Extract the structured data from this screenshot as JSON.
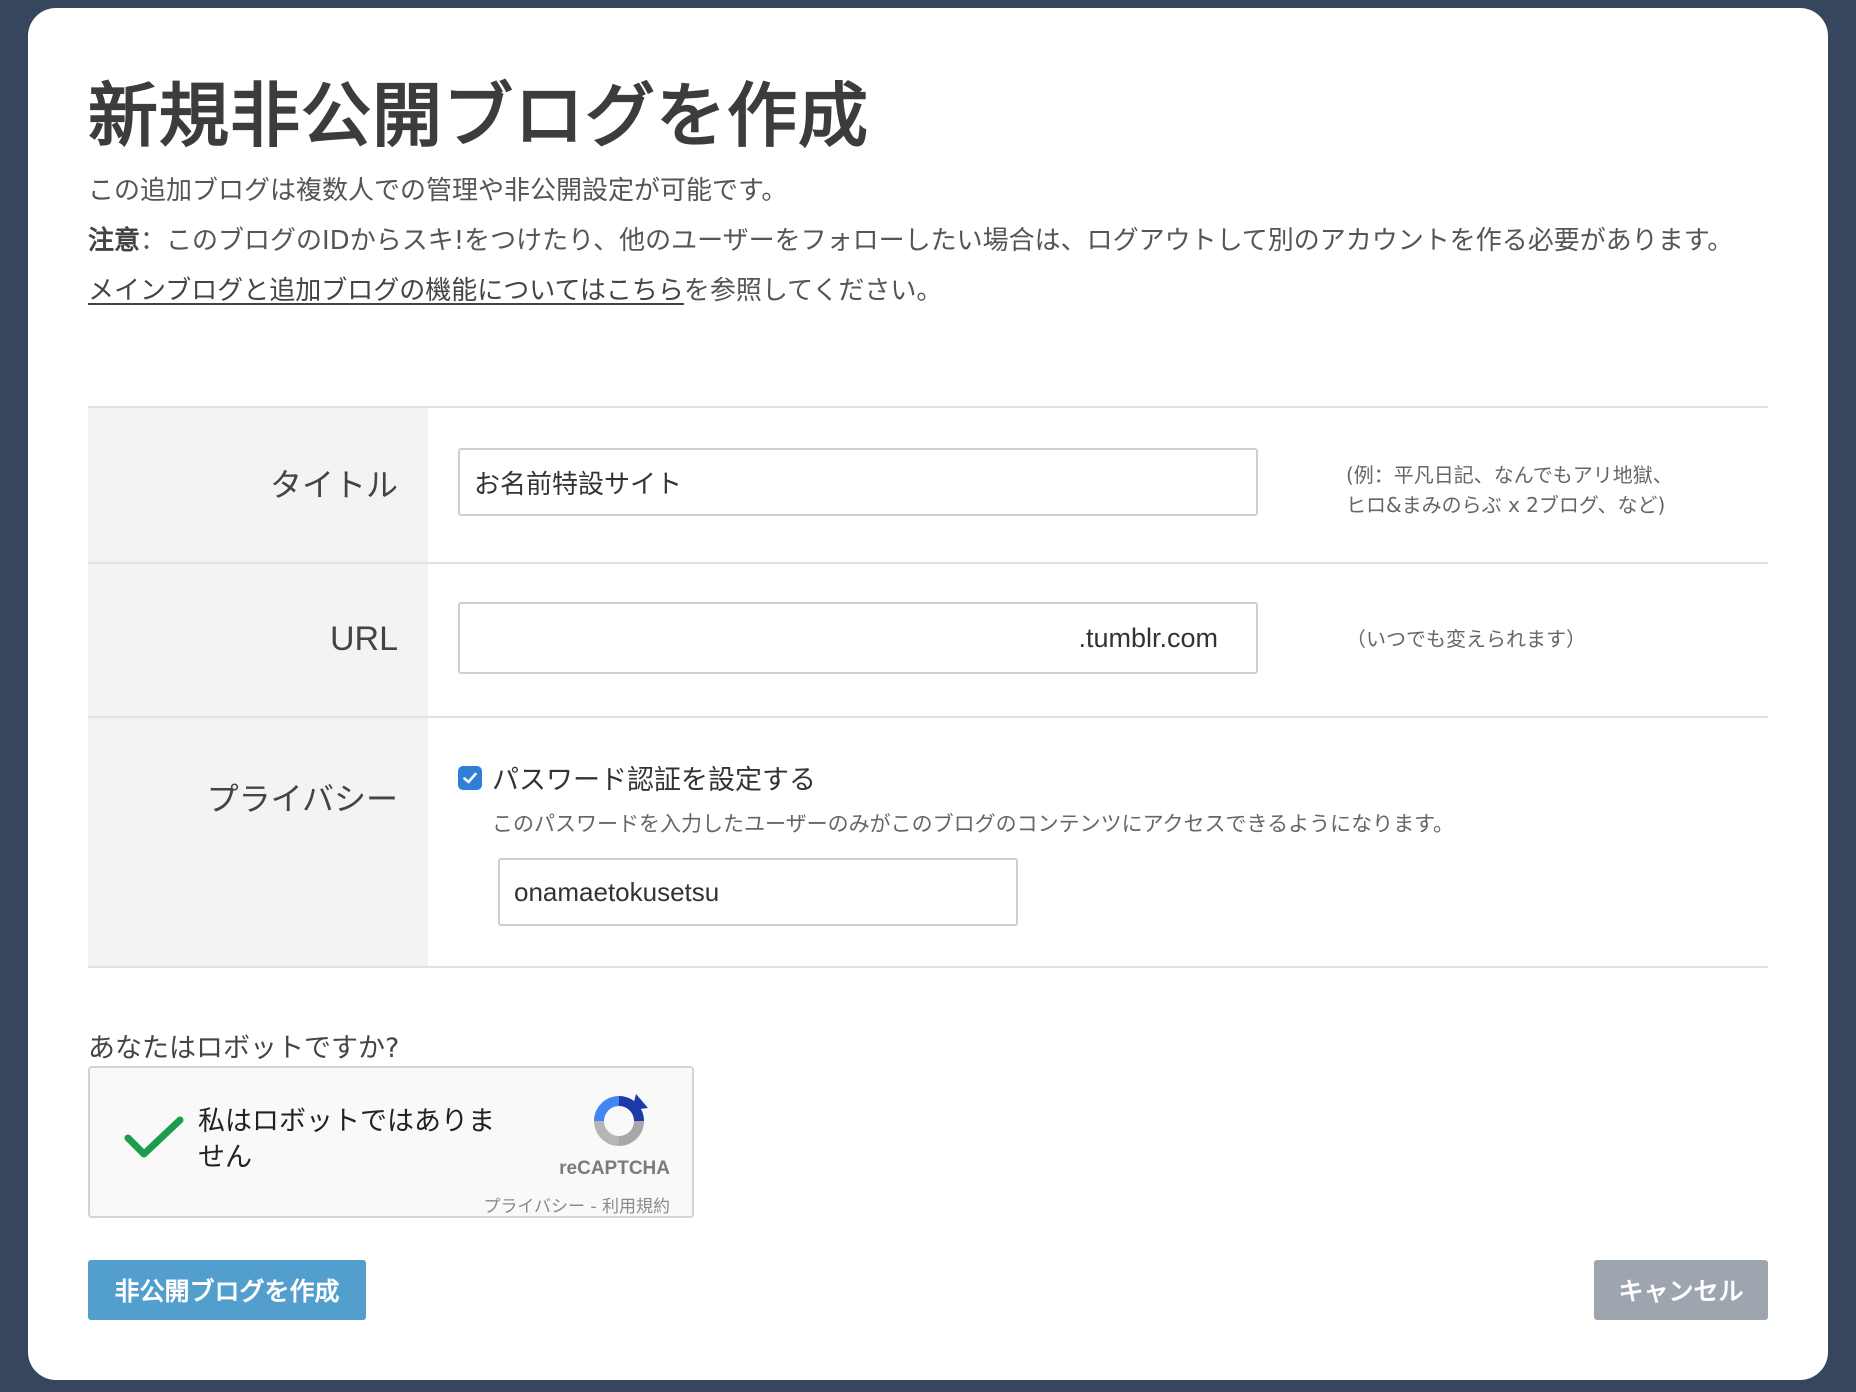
{
  "page": {
    "title": "新規非公開ブログを作成",
    "intro_line1": "この追加ブログは複数人での管理や非公開設定が可能です。",
    "notice_label": "注意",
    "notice_text": "：このブログのIDからスキ!をつけたり、他のユーザーをフォローしたい場合は、ログアウトして別のアカウントを作る必要があります。",
    "help_link": "メインブログと追加ブログの機能についてはこちら",
    "help_suffix": "を参照してください。"
  },
  "form": {
    "title_label": "タイトル",
    "title_value": "お名前特設サイト",
    "title_hint_1": "(例：平凡日記、なんでもアリ地獄、",
    "title_hint_2": "ヒロ&まみのらぶ x 2ブログ、など)",
    "url_label": "URL",
    "url_suffix": ".tumblr.com",
    "url_hint": "（いつでも変えられます）",
    "privacy_label": "プライバシー",
    "password_checkbox_label": "パスワード認証を設定する",
    "password_checked": true,
    "password_desc": "このパスワードを入力したユーザーのみがこのブログのコンテンツにアクセスできるようになります。",
    "password_value": "onamaetokusetsu"
  },
  "captcha": {
    "question": "あなたはロボットですか?",
    "label": "私はロボットではありません",
    "brand": "reCAPTCHA",
    "links": "プライバシー - 利用規約"
  },
  "buttons": {
    "create": "非公開ブログを作成",
    "cancel": "キャンセル"
  },
  "colors": {
    "background": "#36465d",
    "primary_button": "#529ecc",
    "cancel_button": "#9da6af",
    "checkbox": "#2f7ed8",
    "captcha_check": "#1a9e4b"
  }
}
